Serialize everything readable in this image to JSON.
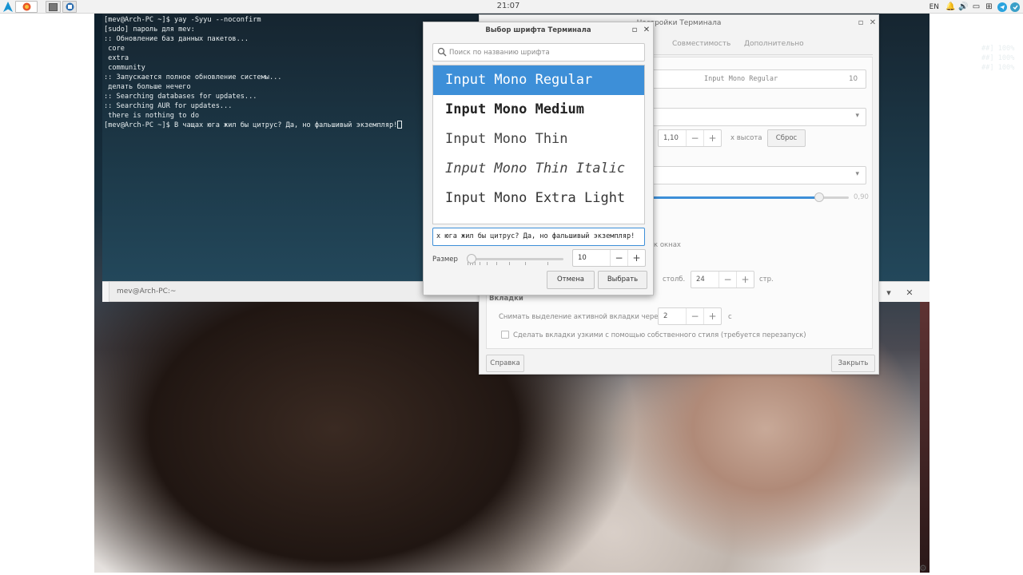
{
  "panel": {
    "clock": "21:07",
    "language": "EN",
    "tray_icons": [
      "bell-icon",
      "volume-icon",
      "battery-icon",
      "network-icon",
      "telegram-icon",
      "update-icon"
    ]
  },
  "terminal": {
    "lines": [
      "[mev@Arch-PC ~]$ yay -Syyu --noconfirm",
      "[sudo] пароль для mev:",
      ":: Обновление баз данных пакетов...",
      " core",
      " extra",
      " community",
      ":: Запускается полное обновление системы...",
      " делать больше нечего",
      ":: Searching databases for updates...",
      ":: Searching AUR for updates...",
      " there is nothing to do",
      "[mev@Arch-PC ~]$ В чащах юга жил бы цитрус? Да, но фальшивый экземпляр!"
    ],
    "right_lines": [
      "##] 100%",
      "##] 100%",
      "##] 100%"
    ],
    "tab_label": "mev@Arch-PC:~"
  },
  "prefs": {
    "title": "Настройки Терминала",
    "tabs": [
      "Совместимость",
      "Дополнительно"
    ],
    "font_value": "Input Mono Regular",
    "font_size": "10",
    "line_spacing": "1,10",
    "height_label": "х высота",
    "reset_label": "Сброс",
    "opacity_value": "0,90",
    "windows_tail": "к окнах",
    "cols_label": "столб.",
    "rows_value": "24",
    "rows_label": "стр.",
    "tabs_section": "Вкладки",
    "unselect_label": "Снимать выделение активной вкладки через",
    "unselect_value": "2",
    "unselect_unit": "с",
    "narrow_tabs_label": "Сделать вкладки узкими с помощью собственного стиля (требуется перезапуск)",
    "help_label": "Справка",
    "close_label": "Закрыть"
  },
  "font_dialog": {
    "title": "Выбор шрифта Терминала",
    "search_placeholder": "Поиск по названию шрифта",
    "fonts": [
      {
        "name": "Input Mono Regular",
        "selected": true
      },
      {
        "name": "Input Mono Medium",
        "selected": false
      },
      {
        "name": "Input Mono Thin",
        "selected": false
      },
      {
        "name": "Input Mono Thin Italic",
        "selected": false
      },
      {
        "name": "Input Mono Extra Light",
        "selected": false
      }
    ],
    "preview_text": "х юга жил бы цитрус? Да, но фальшивый экземпляр!",
    "size_label": "Размер",
    "size_value": "10",
    "cancel_label": "Отмена",
    "select_label": "Выбрать"
  },
  "colors": {
    "accent": "#3d8fd8",
    "terminal_bg": "#1d3a4a",
    "terminal_fg": "#e8eef0"
  }
}
